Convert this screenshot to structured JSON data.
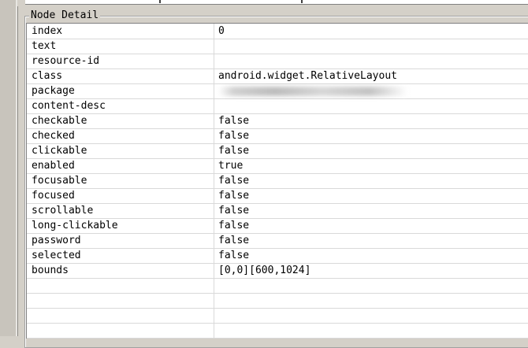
{
  "group_title": "Node Detail",
  "rows": [
    {
      "key": "index",
      "value": "0"
    },
    {
      "key": "text",
      "value": ""
    },
    {
      "key": "resource-id",
      "value": ""
    },
    {
      "key": "class",
      "value": "android.widget.RelativeLayout"
    },
    {
      "key": "package",
      "value": ""
    },
    {
      "key": "content-desc",
      "value": ""
    },
    {
      "key": "checkable",
      "value": "false"
    },
    {
      "key": "checked",
      "value": "false"
    },
    {
      "key": "clickable",
      "value": "false"
    },
    {
      "key": "enabled",
      "value": "true"
    },
    {
      "key": "focusable",
      "value": "false"
    },
    {
      "key": "focused",
      "value": "false"
    },
    {
      "key": "scrollable",
      "value": "false"
    },
    {
      "key": "long-clickable",
      "value": "false"
    },
    {
      "key": "password",
      "value": "false"
    },
    {
      "key": "selected",
      "value": "false"
    },
    {
      "key": "bounds",
      "value": "[0,0][600,1024]"
    }
  ]
}
